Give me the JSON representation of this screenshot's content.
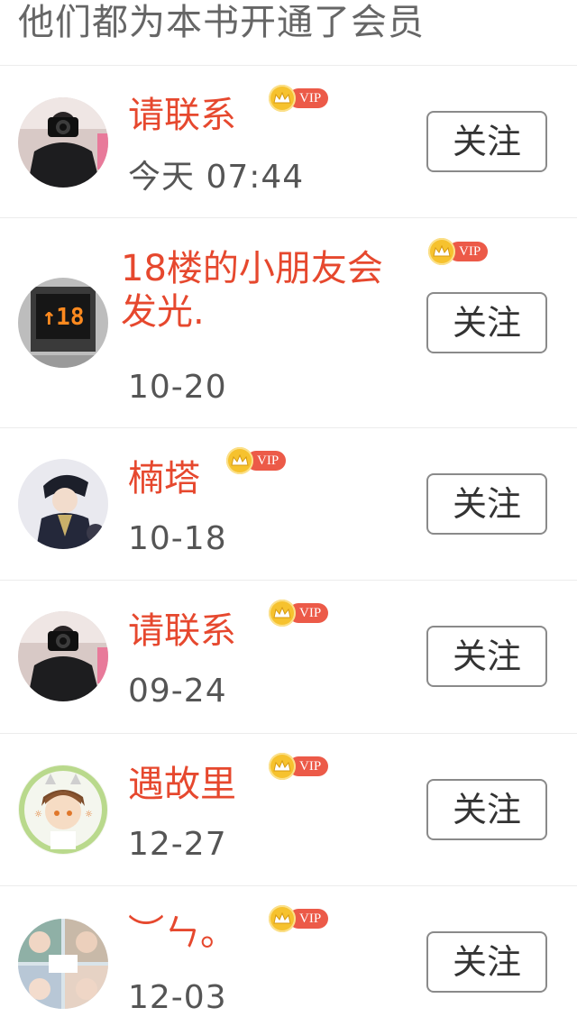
{
  "header": {
    "title": "他们都为本书开通了会员"
  },
  "vip_label": "VIP",
  "follow_label": "关注",
  "colors": {
    "name": "#e6482e",
    "vip_pill": "#ec5a48",
    "vip_crown": "#f6c22e",
    "date": "#555555"
  },
  "members": [
    {
      "name": "请联系",
      "time": "今天 07:44",
      "avatar": "camera-selfie-avatar"
    },
    {
      "name": "18楼的小朋友会发光.",
      "time": "10-20",
      "avatar": "elevator-18-avatar"
    },
    {
      "name": "楠塔",
      "time": "10-18",
      "avatar": "anime-character-avatar"
    },
    {
      "name": "请联系",
      "time": "09-24",
      "avatar": "camera-selfie-avatar"
    },
    {
      "name": "遇故里",
      "time": "12-27",
      "avatar": "cartoon-boy-avatar"
    },
    {
      "name": "︶ㄣ。",
      "time": "12-03",
      "avatar": "photo-collage-avatar"
    }
  ]
}
